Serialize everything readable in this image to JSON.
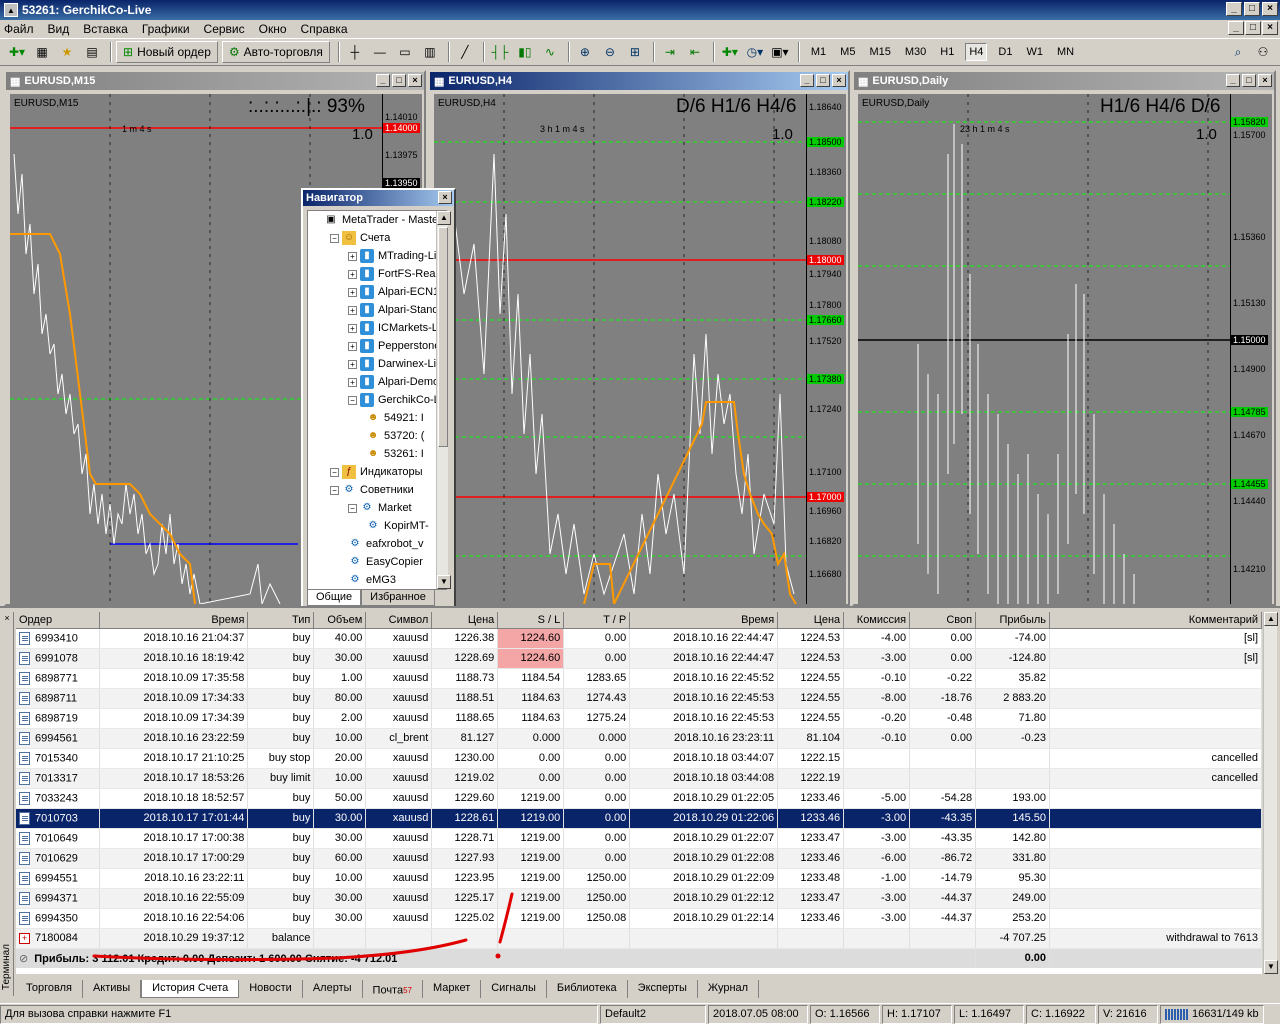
{
  "window": {
    "title": "53261: GerchikCo-Live",
    "min": "_",
    "max": "□",
    "close": "×"
  },
  "menu": [
    "Файл",
    "Вид",
    "Вставка",
    "Графики",
    "Сервис",
    "Окно",
    "Справка"
  ],
  "toolbar": {
    "new_order": "Новый ордер",
    "auto_trading": "Авто-торговля",
    "timeframes": [
      "M1",
      "M5",
      "M15",
      "M30",
      "H1",
      "H4",
      "D1",
      "W1",
      "MN"
    ],
    "active_timeframe": "H4"
  },
  "charts": [
    {
      "title": "EURUSD,M15",
      "symbol_label": "EURUSD,M15",
      "indicator_text": ":..:.:...:.|.:  93%",
      "ratio": "1.0",
      "countdown": "1 m 4 s",
      "prices": [
        "1.14010",
        "1.14000",
        "1.13975",
        "1.13950"
      ]
    },
    {
      "title": "EURUSD,H4",
      "symbol_label": "EURUSD,H4",
      "indicator_text": "D/6  H1/6  H4/6",
      "ratio": "1.0",
      "countdown": "3 h 1 m 4 s",
      "prices": [
        "1.18640",
        "1.18500",
        "1.18360",
        "1.18220",
        "1.18080",
        "1.18000",
        "1.17940",
        "1.17800",
        "1.17660",
        "1.17520",
        "1.17380",
        "1.17240",
        "1.17100",
        "1.17000",
        "1.16960",
        "1.16820",
        "1.16680"
      ]
    },
    {
      "title": "EURUSD,Daily",
      "symbol_label": "EURUSD,Daily",
      "indicator_text": "H1/6  H4/6  D/6",
      "ratio": "1.0",
      "countdown": "23 h 1 m 4 s",
      "prices": [
        "1.15820",
        "1.15700",
        "1.15360",
        "1.15130",
        "1.15000",
        "1.14900",
        "1.14785",
        "1.14670",
        "1.14455",
        "1.14440",
        "1.14210"
      ]
    }
  ],
  "navigator": {
    "title": "Навигатор",
    "items": [
      {
        "label": "MetaTrader - Masterf",
        "level": 0,
        "icon": "mt"
      },
      {
        "label": "Счета",
        "level": 1,
        "icon": "fld"
      },
      {
        "label": "MTrading-Liv",
        "level": 2,
        "icon": "acc"
      },
      {
        "label": "FortFS-Real",
        "level": 2,
        "icon": "acc"
      },
      {
        "label": "Alpari-ECN1",
        "level": 2,
        "icon": "acc"
      },
      {
        "label": "Alpari-Standa",
        "level": 2,
        "icon": "acc"
      },
      {
        "label": "ICMarkets-Li",
        "level": 2,
        "icon": "acc"
      },
      {
        "label": "Pepperstone",
        "level": 2,
        "icon": "acc"
      },
      {
        "label": "Darwinex-Liv",
        "level": 2,
        "icon": "acc"
      },
      {
        "label": "Alpari-Demo",
        "level": 2,
        "icon": "acc"
      },
      {
        "label": "GerchikCo-Li",
        "level": 2,
        "icon": "acc"
      },
      {
        "label": "54921: I",
        "level": 3,
        "icon": "usr"
      },
      {
        "label": "53720: (",
        "level": 3,
        "icon": "usr"
      },
      {
        "label": "53261: I",
        "level": 3,
        "icon": "usr"
      },
      {
        "label": "Индикаторы",
        "level": 1,
        "icon": "ind"
      },
      {
        "label": "Советники",
        "level": 1,
        "icon": "adv"
      },
      {
        "label": "Market",
        "level": 2,
        "icon": "adv"
      },
      {
        "label": "KopirMT-",
        "level": 3,
        "icon": "adv"
      },
      {
        "label": "eafxrobot_v",
        "level": 2,
        "icon": "adv"
      },
      {
        "label": "EasyCopier",
        "level": 2,
        "icon": "adv"
      },
      {
        "label": "eMG3",
        "level": 2,
        "icon": "adv"
      }
    ],
    "tabs": [
      "Общие",
      "Избранное"
    ]
  },
  "history": {
    "columns": [
      "Ордер",
      "Время",
      "Тип",
      "Объем",
      "Символ",
      "Цена",
      "S / L",
      "T / P",
      "Время",
      "Цена",
      "Комиссия",
      "Своп",
      "Прибыль",
      "Комментарий"
    ],
    "rows": [
      [
        "6993410",
        "2018.10.16 21:04:37",
        "buy",
        "40.00",
        "xauusd",
        "1226.38",
        "1224.60",
        "0.00",
        "2018.10.16 22:44:47",
        "1224.53",
        "-4.00",
        "0.00",
        "-74.00",
        "[sl]"
      ],
      [
        "6991078",
        "2018.10.16 18:19:42",
        "buy",
        "30.00",
        "xauusd",
        "1228.69",
        "1224.60",
        "0.00",
        "2018.10.16 22:44:47",
        "1224.53",
        "-3.00",
        "0.00",
        "-124.80",
        "[sl]"
      ],
      [
        "6898771",
        "2018.10.09 17:35:58",
        "buy",
        "1.00",
        "xauusd",
        "1188.73",
        "1184.54",
        "1283.65",
        "2018.10.16 22:45:52",
        "1224.55",
        "-0.10",
        "-0.22",
        "35.82",
        ""
      ],
      [
        "6898711",
        "2018.10.09 17:34:33",
        "buy",
        "80.00",
        "xauusd",
        "1188.51",
        "1184.63",
        "1274.43",
        "2018.10.16 22:45:53",
        "1224.55",
        "-8.00",
        "-18.76",
        "2 883.20",
        ""
      ],
      [
        "6898719",
        "2018.10.09 17:34:39",
        "buy",
        "2.00",
        "xauusd",
        "1188.65",
        "1184.63",
        "1275.24",
        "2018.10.16 22:45:53",
        "1224.55",
        "-0.20",
        "-0.48",
        "71.80",
        ""
      ],
      [
        "6994561",
        "2018.10.16 23:22:59",
        "buy",
        "10.00",
        "cl_brent",
        "81.127",
        "0.000",
        "0.000",
        "2018.10.16 23:23:11",
        "81.104",
        "-0.10",
        "0.00",
        "-0.23",
        ""
      ],
      [
        "7015340",
        "2018.10.17 21:10:25",
        "buy stop",
        "20.00",
        "xauusd",
        "1230.00",
        "0.00",
        "0.00",
        "2018.10.18 03:44:07",
        "1222.15",
        "",
        "",
        "",
        "cancelled"
      ],
      [
        "7013317",
        "2018.10.17 18:53:26",
        "buy limit",
        "10.00",
        "xauusd",
        "1219.02",
        "0.00",
        "0.00",
        "2018.10.18 03:44:08",
        "1222.19",
        "",
        "",
        "",
        "cancelled"
      ],
      [
        "7033243",
        "2018.10.18 18:52:57",
        "buy",
        "50.00",
        "xauusd",
        "1229.60",
        "1219.00",
        "0.00",
        "2018.10.29 01:22:05",
        "1233.46",
        "-5.00",
        "-54.28",
        "193.00",
        ""
      ],
      [
        "7010703",
        "2018.10.17 17:01:44",
        "buy",
        "30.00",
        "xauusd",
        "1228.61",
        "1219.00",
        "0.00",
        "2018.10.29 01:22:06",
        "1233.46",
        "-3.00",
        "-43.35",
        "145.50",
        ""
      ],
      [
        "7010649",
        "2018.10.17 17:00:38",
        "buy",
        "30.00",
        "xauusd",
        "1228.71",
        "1219.00",
        "0.00",
        "2018.10.29 01:22:07",
        "1233.47",
        "-3.00",
        "-43.35",
        "142.80",
        ""
      ],
      [
        "7010629",
        "2018.10.17 17:00:29",
        "buy",
        "60.00",
        "xauusd",
        "1227.93",
        "1219.00",
        "0.00",
        "2018.10.29 01:22:08",
        "1233.46",
        "-6.00",
        "-86.72",
        "331.80",
        ""
      ],
      [
        "6994551",
        "2018.10.16 23:22:11",
        "buy",
        "10.00",
        "xauusd",
        "1223.95",
        "1219.00",
        "1250.00",
        "2018.10.29 01:22:09",
        "1233.48",
        "-1.00",
        "-14.79",
        "95.30",
        ""
      ],
      [
        "6994371",
        "2018.10.16 22:55:09",
        "buy",
        "30.00",
        "xauusd",
        "1225.17",
        "1219.00",
        "1250.00",
        "2018.10.29 01:22:12",
        "1233.47",
        "-3.00",
        "-44.37",
        "249.00",
        ""
      ],
      [
        "6994350",
        "2018.10.16 22:54:06",
        "buy",
        "30.00",
        "xauusd",
        "1225.02",
        "1219.00",
        "1250.08",
        "2018.10.29 01:22:14",
        "1233.46",
        "-3.00",
        "-44.37",
        "253.20",
        ""
      ],
      [
        "7180084",
        "2018.10.29 19:37:12",
        "balance",
        "",
        "",
        "",
        "",
        "",
        "",
        "",
        "",
        "",
        "-4 707.25",
        "withdrawal to 7613"
      ]
    ],
    "selected_order": "7010703",
    "sl_highlighted_orders": [
      "6993410",
      "6991078"
    ],
    "summary": "Прибыль: 3 112.01  Кредит: 0.00  Депозит: 1 600.00  Снятие: -4 712.01",
    "summary_total": "0.00"
  },
  "terminal": {
    "label": "Терминал",
    "tabs": [
      "Торговля",
      "Активы",
      "История Счета",
      "Новости",
      "Алерты",
      "Почта",
      "Маркет",
      "Сигналы",
      "Библиотека",
      "Эксперты",
      "Журнал"
    ],
    "active_tab": "История Счета",
    "mail_badge": "57"
  },
  "status": {
    "help": "Для вызова справки нажмите F1",
    "profile": "Default2",
    "datetime": "2018.07.05 08:00",
    "open": "O: 1.16566",
    "high": "H: 1.17107",
    "low": "L: 1.16497",
    "close": "C: 1.16922",
    "volume": "V: 21616",
    "traffic": "16631/149 kb"
  },
  "colors": {
    "selection": "#0a246a",
    "sl_highlight": "#f4a6a6",
    "level_red": "#ff0000",
    "level_green": "#00ff00",
    "ma": "#ff9900",
    "annotation": "#e00000"
  }
}
